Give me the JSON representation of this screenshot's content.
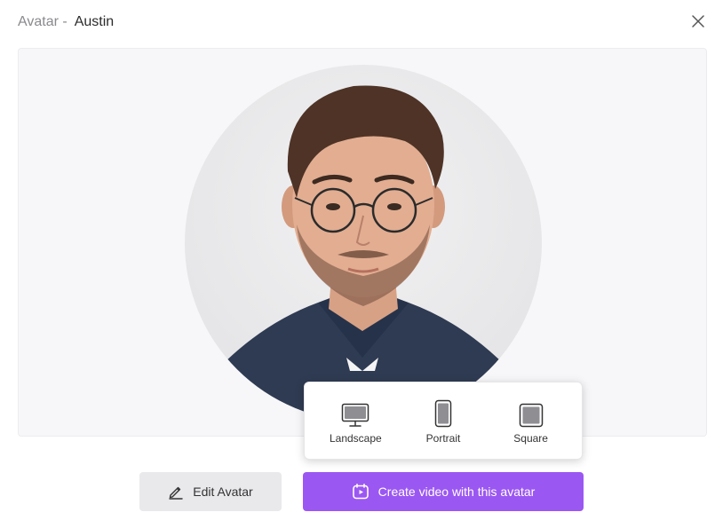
{
  "dialog": {
    "title_prefix": "Avatar -",
    "avatar_name": "Austin"
  },
  "aspect_options": [
    {
      "label": "Landscape",
      "ratio": "16:9",
      "icon": "landscape-monitor-icon"
    },
    {
      "label": "Portrait",
      "ratio": "9/16",
      "icon": "portrait-phone-icon"
    },
    {
      "label": "Square",
      "ratio": "1:1",
      "icon": "square-frame-icon"
    }
  ],
  "actions": {
    "edit_label": "Edit Avatar",
    "create_label": "Create video with this avatar"
  },
  "colors": {
    "primary": "#9b57f2",
    "preview_bg": "#f7f7f9",
    "shirt": "#2f3b52"
  }
}
